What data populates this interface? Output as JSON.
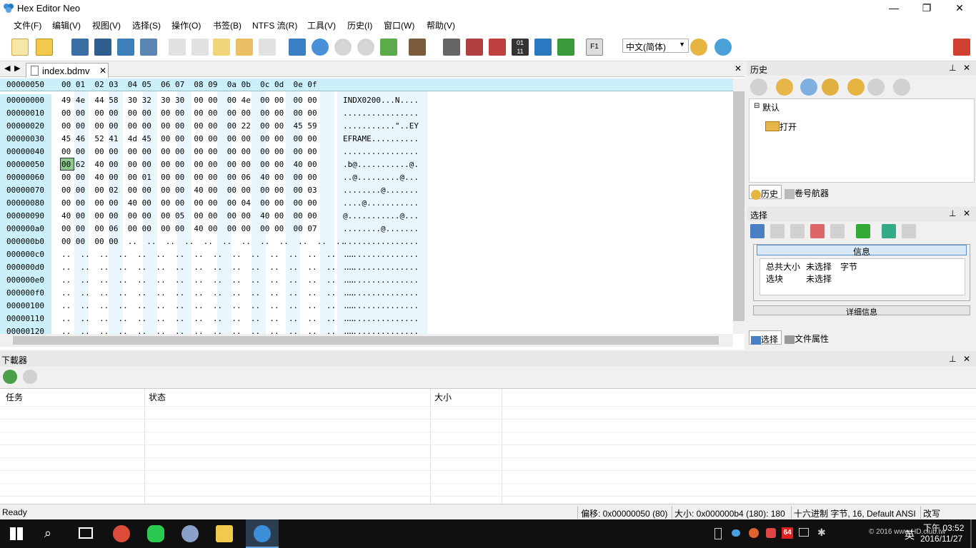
{
  "window": {
    "title": "Hex Editor Neo",
    "min": "—",
    "max": "❐",
    "close": "✕"
  },
  "menu": [
    "文件(F)",
    "编辑(V)",
    "视图(V)",
    "选择(S)",
    "操作(O)",
    "书签(B)",
    "NTFS 流(R)",
    "工具(V)",
    "历史(I)",
    "窗口(W)",
    "帮助(V)"
  ],
  "toolbar": {
    "language": "中文(简体)"
  },
  "editor": {
    "tab": "index.bdmv",
    "header_offset": "00000050",
    "header_cols": "00 01  02 03  04 05  06 07  08 09  0a 0b  0c 0d  0e 0f",
    "rows": [
      {
        "off": "00000000",
        "hex": "49 4e  44 58  30 32  30 30  00 00  00 4e  00 00  00 00",
        "ascii": "INDX0200...N...."
      },
      {
        "off": "00000010",
        "hex": "00 00  00 00  00 00  00 00  00 00  00 00  00 00  00 00",
        "ascii": "................"
      },
      {
        "off": "00000020",
        "hex": "00 00  00 00  00 00  00 00  00 00  00 22  00 00  45 59",
        "ascii": "...........\"..EY"
      },
      {
        "off": "00000030",
        "hex": "45 46  52 41  4d 45  00 00  00 00  00 00  00 00  00 00",
        "ascii": "EFRAME.........."
      },
      {
        "off": "00000040",
        "hex": "00 00  00 00  00 00  00 00  00 00  00 00  00 00  00 00",
        "ascii": "................"
      },
      {
        "off": "00000050",
        "hex": "00 62  40 00  00 00  00 00  00 00  00 00  00 00  40 00",
        "ascii": ".b@...........@."
      },
      {
        "off": "00000060",
        "hex": "00 00  40 00  00 01  00 00  00 00  00 06  40 00  00 00",
        "ascii": "..@.........@..."
      },
      {
        "off": "00000070",
        "hex": "00 00  00 02  00 00  00 00  40 00  00 00  00 00  00 03",
        "ascii": "........@......."
      },
      {
        "off": "00000080",
        "hex": "00 00  00 00  40 00  00 00  00 00  00 04  00 00  00 00",
        "ascii": "....@..........."
      },
      {
        "off": "00000090",
        "hex": "40 00  00 00  00 00  00 05  00 00  00 00  40 00  00 00",
        "ascii": "@...........@..."
      },
      {
        "off": "000000a0",
        "hex": "00 00  00 06  00 00  00 00  40 00  00 00  00 00  00 07",
        "ascii": "........@......."
      },
      {
        "off": "000000b0",
        "hex": "00 00  00 00  ..  ..  ..  ..  ..  ..  ..  ..  ..  ..  ..  ..",
        "ascii": "................"
      },
      {
        "off": "000000c0",
        "hex": "..  ..  ..  ..  ..  ..  ..  ..  ..  ..  ..  ..  ..  ..  ..  ..",
        "ascii": "................"
      },
      {
        "off": "000000d0",
        "hex": "..  ..  ..  ..  ..  ..  ..  ..  ..  ..  ..  ..  ..  ..  ..  ..",
        "ascii": "................"
      },
      {
        "off": "000000e0",
        "hex": "..  ..  ..  ..  ..  ..  ..  ..  ..  ..  ..  ..  ..  ..  ..  ..",
        "ascii": "................"
      },
      {
        "off": "000000f0",
        "hex": "..  ..  ..  ..  ..  ..  ..  ..  ..  ..  ..  ..  ..  ..  ..  ..",
        "ascii": "................"
      },
      {
        "off": "00000100",
        "hex": "..  ..  ..  ..  ..  ..  ..  ..  ..  ..  ..  ..  ..  ..  ..  ..",
        "ascii": "................"
      },
      {
        "off": "00000110",
        "hex": "..  ..  ..  ..  ..  ..  ..  ..  ..  ..  ..  ..  ..  ..  ..  ..",
        "ascii": "................"
      },
      {
        "off": "00000120",
        "hex": "..  ..  ..  ..  ..  ..  ..  ..  ..  ..  ..  ..  ..  ..  ..  ..",
        "ascii": "................"
      }
    ]
  },
  "history_panel": {
    "title": "历史",
    "root": "默认",
    "item": "打开",
    "tab1": "历史",
    "tab2": "卷号航器"
  },
  "selection_panel": {
    "title": "选择",
    "info_header": "信息",
    "total_label": "总共大小",
    "total_value": "未选择",
    "total_unit": "字节",
    "block_label": "选块",
    "block_value": "未选择",
    "details": "详细信息",
    "tab1": "选择",
    "tab2": "文件属性"
  },
  "downloader": {
    "title": "下載器",
    "col_task": "任务",
    "col_status": "状态",
    "col_size": "大小"
  },
  "status": {
    "ready": "Ready",
    "offset": "偏移: 0x00000050 (80)",
    "size": "大小: 0x000000b4 (180): 180",
    "mode": "十六进制 字节, 16, Default ANSI",
    "overwrite": "改写"
  },
  "taskbar": {
    "time": "下午 03:52",
    "date": "2016/11/27",
    "ime": "英",
    "badge": "64",
    "watermark": "© 2016 www.HD.club.tw"
  }
}
